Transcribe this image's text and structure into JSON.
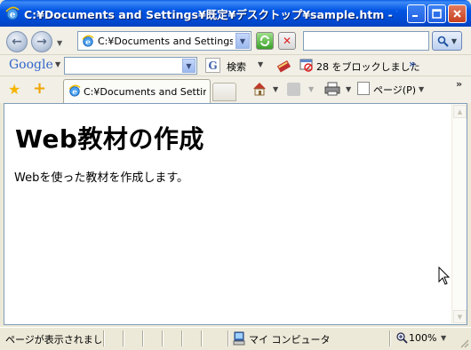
{
  "window": {
    "title": "C:¥Documents and Settings¥既定¥デスクトップ¥sample.htm - Win..."
  },
  "navbar": {
    "address": "C:¥Documents and Settings¥既",
    "search_value": ""
  },
  "google_toolbar": {
    "logo_text": "Google",
    "search_value": "",
    "search_label": "検索",
    "blocked_label": "28 をブロックしました",
    "more_symbol": "»"
  },
  "tabs": {
    "active_tab_label": "C:¥Documents and Settin...",
    "page_menu_label": "ページ(P)",
    "more_symbol": "»"
  },
  "page": {
    "heading": "Web教材の作成",
    "paragraph": "Webを使った教材を作成します。"
  },
  "statusbar": {
    "status_text": "ページが表示されました",
    "zone_label": "マイ コンピュータ",
    "zoom_label": "100%"
  },
  "colors": {
    "titlebar": "#0054e3",
    "chrome_bg": "#ece9d8",
    "toolbar_bg": "#f1efe6"
  },
  "icons": [
    "ie-icon",
    "minimize-icon",
    "maximize-icon",
    "close-icon",
    "back-icon",
    "forward-icon",
    "refresh-icon",
    "stop-icon",
    "search-icon",
    "favorites-star-icon",
    "add-favorites-icon",
    "home-icon",
    "feed-icon",
    "print-icon",
    "page-icon",
    "computer-icon",
    "zoom-icon"
  ]
}
